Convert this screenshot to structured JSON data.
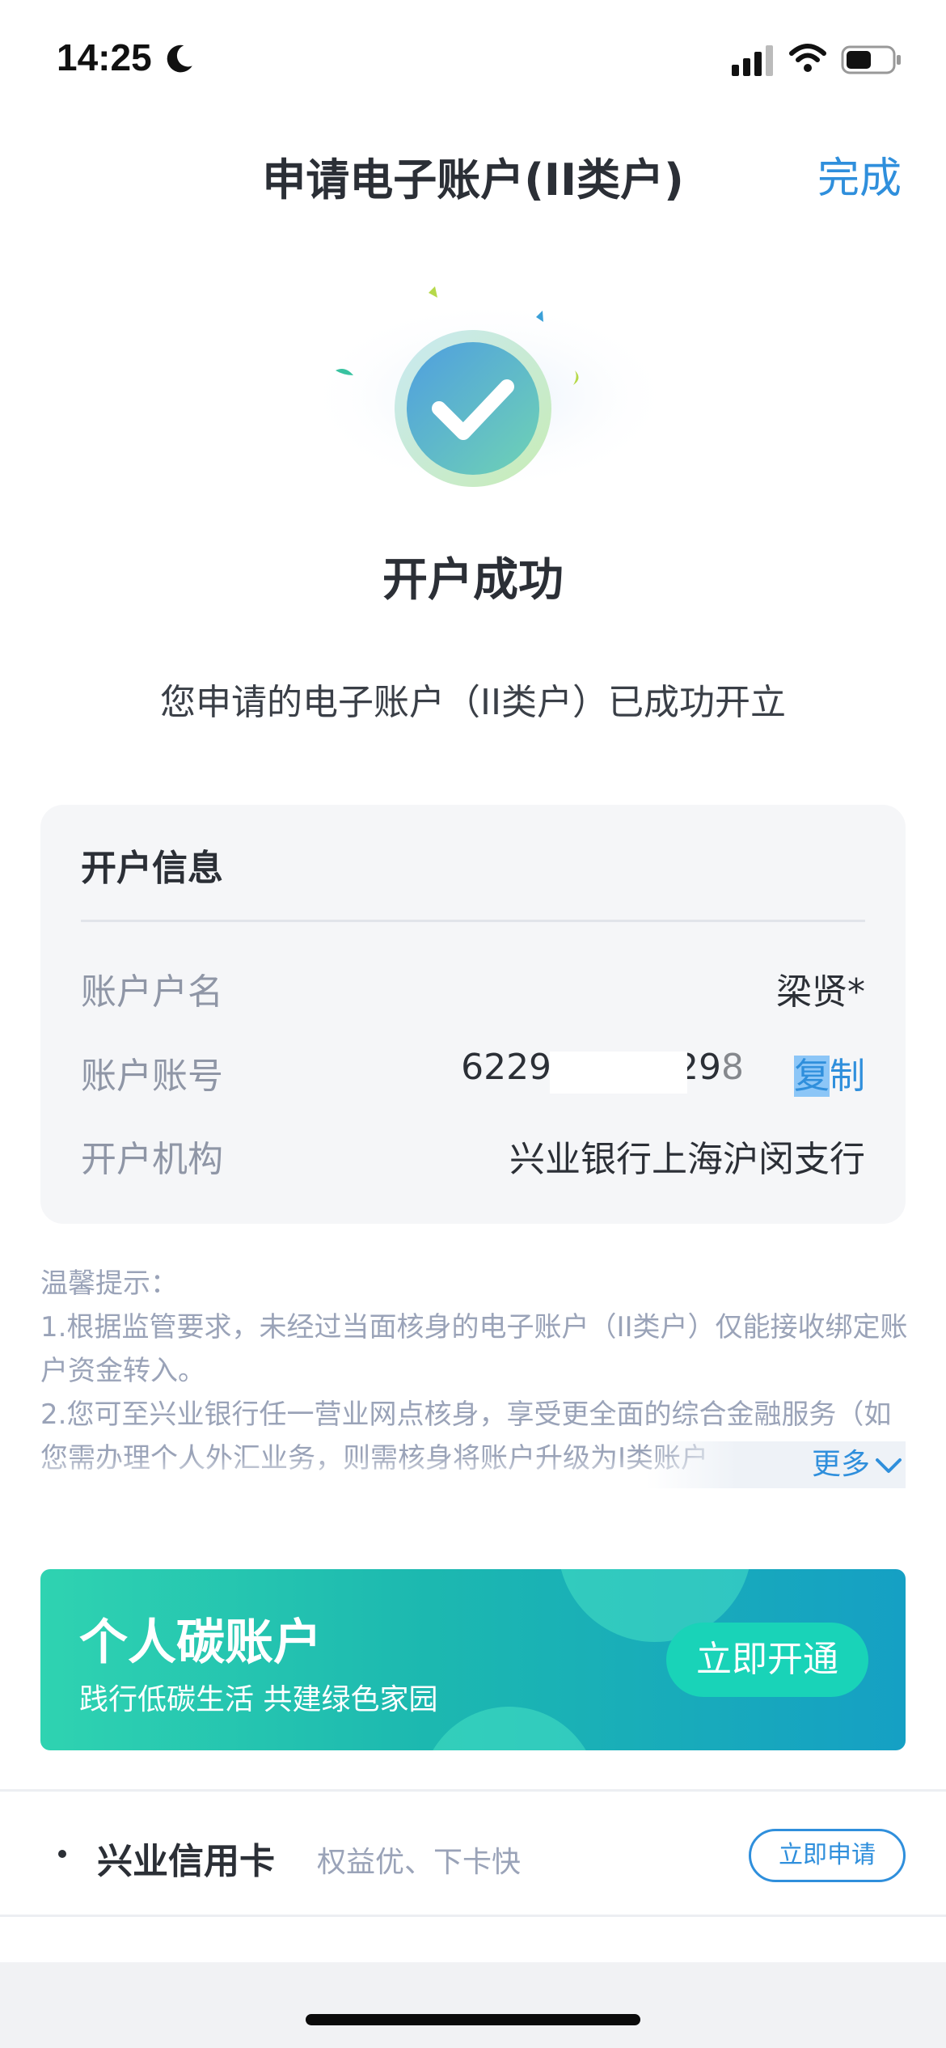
{
  "status_bar": {
    "time": "14:25",
    "battery_level": 0.55
  },
  "nav": {
    "title": "申请电子账户(II类户)",
    "done_label": "完成"
  },
  "success": {
    "title": "开户成功",
    "subtitle": "您申请的电子账户（II类户）已成功开立"
  },
  "account_info": {
    "title": "开户信息",
    "rows": [
      {
        "label": "账户户名",
        "value": "梁贤*"
      },
      {
        "label": "账户账号",
        "value": "622908 21329",
        "value_tail": "8"
      },
      {
        "label": "开户机构",
        "value": "兴业银行上海沪闵支行"
      }
    ],
    "copy_label_hidden": "复",
    "copy_label": "制"
  },
  "tips": {
    "heading": "温馨提示：",
    "lines": [
      "1.根据监管要求，未经过当面核身的电子账户（II类户）仅能接收绑定账户资金转入。",
      "2.您可至兴业银行任一营业网点核身，享受更全面的综合金融服务（如您需办理个人外汇业务，则需核身将账户升级为I类账户"
    ],
    "more_label": "更多"
  },
  "carbon_banner": {
    "title": "个人碳账户",
    "subtitle": "践行低碳生活 共建绿色家园",
    "button_label": "立即开通"
  },
  "credit_card": {
    "title": "兴业信用卡",
    "description": "权益优、下卡快",
    "button_label": "立即申请"
  },
  "colors": {
    "accent_blue": "#2f8fdc",
    "banner_teal": "#1cb8b0",
    "success_green": "#7fd6a8"
  }
}
